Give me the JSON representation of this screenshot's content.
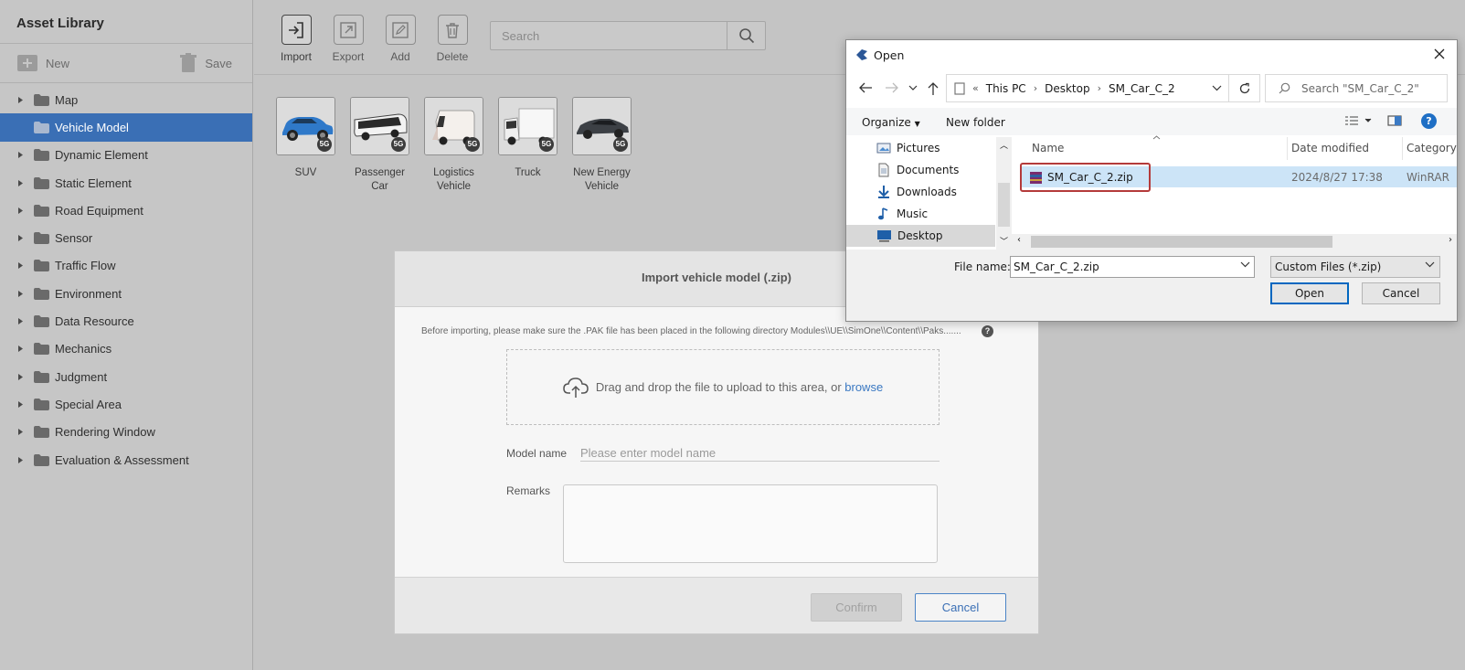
{
  "sidebar": {
    "title": "Asset Library",
    "new_label": "New",
    "save_label": "Save",
    "items": [
      {
        "label": "Map"
      },
      {
        "label": "Vehicle Model",
        "selected": true
      },
      {
        "label": "Dynamic Element"
      },
      {
        "label": "Static Element"
      },
      {
        "label": "Road Equipment"
      },
      {
        "label": "Sensor"
      },
      {
        "label": "Traffic Flow"
      },
      {
        "label": "Environment"
      },
      {
        "label": "Data Resource"
      },
      {
        "label": "Mechanics"
      },
      {
        "label": "Judgment"
      },
      {
        "label": "Special Area"
      },
      {
        "label": "Rendering Window"
      },
      {
        "label": "Evaluation & Assessment"
      }
    ]
  },
  "toolbar": {
    "import_label": "Import",
    "export_label": "Export",
    "add_label": "Add",
    "delete_label": "Delete",
    "search_placeholder": "Search"
  },
  "assets": [
    {
      "label": "SUV",
      "badge": "5G"
    },
    {
      "label": "Passenger Car",
      "badge": "5G"
    },
    {
      "label": "Logistics Vehicle",
      "badge": "5G"
    },
    {
      "label": "Truck",
      "badge": "5G"
    },
    {
      "label": "New Energy Vehicle",
      "badge": "5G"
    }
  ],
  "import_dialog": {
    "title": "Import vehicle model (.zip)",
    "hint": "Before importing, please make sure the .PAK file has been placed in the following directory Modules\\\\UE\\\\SimOne\\\\Content\\\\Paks.......",
    "help": "?",
    "drop_text": "Drag and drop the file to upload to this area, or ",
    "browse_label": "browse",
    "model_name_label": "Model name",
    "model_name_placeholder": "Please enter model name",
    "remarks_label": "Remarks",
    "confirm_label": "Confirm",
    "cancel_label": "Cancel"
  },
  "open_dialog": {
    "title": "Open",
    "breadcrumb": {
      "prefix": "«",
      "items": [
        "This PC",
        "Desktop",
        "SM_Car_C_2"
      ]
    },
    "search_placeholder": "Search \"SM_Car_C_2\"",
    "organize_label": "Organize",
    "new_folder_label": "New folder",
    "help": "?",
    "nav_items": [
      "Pictures",
      "Documents",
      "Downloads",
      "Music",
      "Desktop"
    ],
    "selected_nav": "Desktop",
    "columns": [
      "Name",
      "Date modified",
      "Category"
    ],
    "files": [
      {
        "name": "SM_Car_C_2.zip",
        "date": "2024/8/27 17:38",
        "type": "WinRAR"
      }
    ],
    "file_name_label": "File name:",
    "file_name_value": "SM_Car_C_2.zip",
    "file_type_value": "Custom Files (*.zip)",
    "open_label": "Open",
    "cancel_label": "Cancel"
  },
  "colors": {
    "selection_blue": "#3a6fb5",
    "highlight_box": "#b43a3a",
    "link_blue": "#3a78c2"
  }
}
